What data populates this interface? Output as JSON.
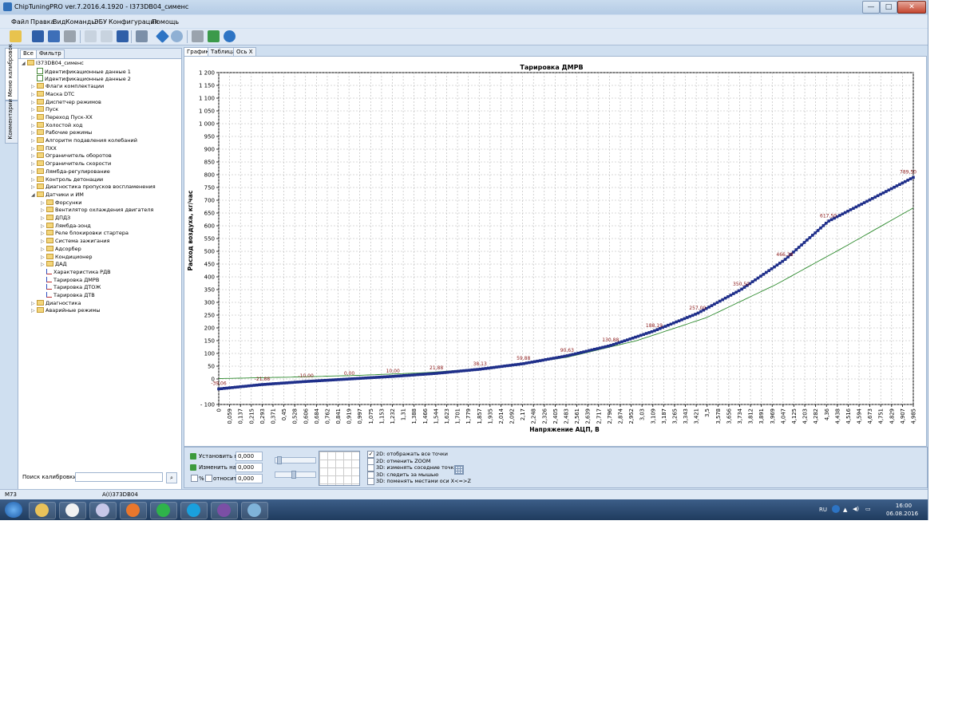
{
  "window": {
    "title": "ChipTuningPRO ver.7.2016.4.1920 - I373DB04_сименс",
    "min": "—",
    "max": "□",
    "close": "✕"
  },
  "menu": [
    "Файл",
    "Правка",
    "Вид",
    "Команды",
    "ЭБУ",
    "Конфигурация",
    "Помощь"
  ],
  "toolbar_icons": [
    "open-folder-icon",
    "save-icon",
    "save-as-icon",
    "print-icon",
    "copy-icon",
    "paste-icon",
    "undo-icon",
    "connect-icon",
    "diamond-icon",
    "search-icon",
    "tools-icon",
    "refresh-icon",
    "help-icon"
  ],
  "vertical_tabs": [
    "Меню калибровок",
    "Комментарии"
  ],
  "sidebar": {
    "tabs": [
      "Все",
      "Фильтр"
    ],
    "tree": [
      {
        "label": "I373DB04_сименс",
        "level": 0,
        "icon": "folder",
        "arrow": "◢"
      },
      {
        "label": "Идентификационные данные 1",
        "level": 1,
        "icon": "table",
        "arrow": ""
      },
      {
        "label": "Идентификационные данные 2",
        "level": 1,
        "icon": "table",
        "arrow": ""
      },
      {
        "label": "Флаги комплектации",
        "level": 1,
        "icon": "folder",
        "arrow": "▷"
      },
      {
        "label": "Маска DTC",
        "level": 1,
        "icon": "folder",
        "arrow": "▷"
      },
      {
        "label": "Диспетчер режимов",
        "level": 1,
        "icon": "folder",
        "arrow": "▷"
      },
      {
        "label": "Пуск",
        "level": 1,
        "icon": "folder",
        "arrow": "▷"
      },
      {
        "label": "Переход Пуск-ХХ",
        "level": 1,
        "icon": "folder",
        "arrow": "▷"
      },
      {
        "label": "Холостой ход",
        "level": 1,
        "icon": "folder",
        "arrow": "▷"
      },
      {
        "label": "Рабочие режимы",
        "level": 1,
        "icon": "folder",
        "arrow": "▷"
      },
      {
        "label": "Алгоритм подавления колебаний",
        "level": 1,
        "icon": "folder",
        "arrow": "▷"
      },
      {
        "label": "ПХХ",
        "level": 1,
        "icon": "folder",
        "arrow": "▷"
      },
      {
        "label": "Ограничитель оборотов",
        "level": 1,
        "icon": "folder",
        "arrow": "▷"
      },
      {
        "label": "Ограничитель скорости",
        "level": 1,
        "icon": "folder",
        "arrow": "▷"
      },
      {
        "label": "Лямбда-регулирование",
        "level": 1,
        "icon": "folder",
        "arrow": "▷"
      },
      {
        "label": "Контроль детонации",
        "level": 1,
        "icon": "folder",
        "arrow": "▷"
      },
      {
        "label": "Диагностика пропусков воспламенения",
        "level": 1,
        "icon": "folder",
        "arrow": "▷"
      },
      {
        "label": "Датчики и ИМ",
        "level": 1,
        "icon": "folder",
        "arrow": "◢"
      },
      {
        "label": "Форсунки",
        "level": 2,
        "icon": "folder",
        "arrow": "▷"
      },
      {
        "label": "Вентилятор охлаждения двигателя",
        "level": 2,
        "icon": "folder",
        "arrow": "▷"
      },
      {
        "label": "ДПДЗ",
        "level": 2,
        "icon": "folder",
        "arrow": "▷"
      },
      {
        "label": "Лямбда-зонд",
        "level": 2,
        "icon": "folder",
        "arrow": "▷"
      },
      {
        "label": "Реле блокировки стартера",
        "level": 2,
        "icon": "folder",
        "arrow": "▷"
      },
      {
        "label": "Система зажигания",
        "level": 2,
        "icon": "folder",
        "arrow": "▷"
      },
      {
        "label": "Адсорбер",
        "level": 2,
        "icon": "folder",
        "arrow": "▷"
      },
      {
        "label": "Кондиционер",
        "level": 2,
        "icon": "folder",
        "arrow": "▷"
      },
      {
        "label": "ДАД",
        "level": 2,
        "icon": "folder",
        "arrow": "▷"
      },
      {
        "label": "Характеристика РДВ",
        "level": 2,
        "icon": "chart",
        "arrow": ""
      },
      {
        "label": "Тарировка ДМРВ",
        "level": 2,
        "icon": "chart",
        "arrow": ""
      },
      {
        "label": "Тарировка ДТОЖ",
        "level": 2,
        "icon": "chart",
        "arrow": ""
      },
      {
        "label": "Тарировка ДТВ",
        "level": 2,
        "icon": "chart",
        "arrow": ""
      },
      {
        "label": "Диагностика",
        "level": 1,
        "icon": "folder",
        "arrow": "▷"
      },
      {
        "label": "Аварийные режимы",
        "level": 1,
        "icon": "folder",
        "arrow": "▷"
      }
    ],
    "search_label": "Поиск калибровки",
    "search_value": ""
  },
  "status": {
    "left": "M73",
    "mid": "A(I)373DB04"
  },
  "chart_tabs": [
    "График",
    "Таблица",
    "Ось X"
  ],
  "controls": {
    "set_label": "Установить в",
    "set_value": "0,000",
    "change_label": "Изменить на",
    "change_value": "0,000",
    "pct_label": "%",
    "rel_label": "относит.",
    "rel_value": "0,000",
    "options": [
      {
        "label": "2D: отображать все точки",
        "checked": true
      },
      {
        "label": "2D: отменить ZOOM",
        "checked": false
      },
      {
        "label": "3D: изменять соседние точки",
        "checked": false
      },
      {
        "label": "3D: следить за мышью",
        "checked": false
      },
      {
        "label": "3D: поменять местами оси X<=>Z",
        "checked": false
      }
    ],
    "check_mark": "✓"
  },
  "taskbar": {
    "apps": [
      {
        "name": "explorer",
        "color": "#e9c25a"
      },
      {
        "name": "paint",
        "color": "#f2f2f2"
      },
      {
        "name": "tool",
        "color": "#c7c7e8"
      },
      {
        "name": "firefox",
        "color": "#e9772d"
      },
      {
        "name": "mail",
        "color": "#2fb34a"
      },
      {
        "name": "skype",
        "color": "#1aa0dd"
      },
      {
        "name": "viber",
        "color": "#7b4fa5"
      },
      {
        "name": "chiptuning",
        "color": "#7fb3d9"
      }
    ],
    "lang": "RU",
    "time": "16:00",
    "date": "06.08.2016"
  },
  "chart_data": {
    "type": "line",
    "title": "Тарировка ДМРВ",
    "xlabel": "Напряжение АЦП, В",
    "ylabel": "Расход воздуха, кг/час",
    "ylim": [
      -100,
      1200
    ],
    "ytick_labels": [
      "- 100",
      "0",
      "50",
      "100",
      "150",
      "200",
      "250",
      "300",
      "350",
      "400",
      "450",
      "500",
      "550",
      "600",
      "650",
      "700",
      "750",
      "800",
      "850",
      "900",
      "950",
      "1 000",
      "1 050",
      "1 100",
      "1 150",
      "1 200"
    ],
    "x_tick_labels": [
      "0",
      "0,059",
      "0,137",
      "0,215",
      "0,293",
      "0,371",
      "0,45",
      "0,528",
      "0,606",
      "0,684",
      "0,762",
      "0,841",
      "0,919",
      "0,997",
      "1,075",
      "1,153",
      "1,232",
      "1,31",
      "1,388",
      "1,466",
      "1,544",
      "1,623",
      "1,701",
      "1,779",
      "1,857",
      "1,935",
      "2,014",
      "2,092",
      "2,17",
      "2,248",
      "2,326",
      "2,405",
      "2,483",
      "2,561",
      "2,639",
      "2,717",
      "2,796",
      "2,874",
      "2,952",
      "3,03",
      "3,109",
      "3,187",
      "3,265",
      "3,343",
      "3,421",
      "3,5",
      "3,578",
      "3,656",
      "3,734",
      "3,812",
      "3,891",
      "3,969",
      "4,047",
      "4,125",
      "4,203",
      "4,282",
      "4,36",
      "4,438",
      "4,516",
      "4,594",
      "4,673",
      "4,751",
      "4,829",
      "4,907",
      "4,985"
    ],
    "grid": true,
    "series": [
      {
        "color": "#1f2f8a",
        "style": "markers",
        "points": [
          [
            0,
            -39.06
          ],
          [
            0.312,
            -21.88
          ],
          [
            0.625,
            -10.0
          ],
          [
            0.937,
            0.0
          ],
          [
            1.25,
            10.0
          ],
          [
            1.562,
            21.88
          ],
          [
            1.875,
            38.13
          ],
          [
            2.187,
            59.88
          ],
          [
            2.5,
            90.63
          ],
          [
            2.812,
            130.88
          ],
          [
            3.125,
            188.19
          ],
          [
            3.437,
            257.0
          ],
          [
            3.75,
            350.5
          ],
          [
            4.062,
            466.38
          ],
          [
            4.375,
            617.5
          ],
          [
            4.985,
            789.5
          ]
        ]
      },
      {
        "color": "#2e8b2e",
        "style": "line",
        "points": [
          [
            0,
            1.5
          ],
          [
            0.5,
            7
          ],
          [
            1.0,
            14
          ],
          [
            1.5,
            25
          ],
          [
            2.0,
            45
          ],
          [
            2.5,
            85
          ],
          [
            3.0,
            150
          ],
          [
            3.5,
            240
          ],
          [
            4.0,
            370
          ],
          [
            4.5,
            520
          ],
          [
            4.985,
            670
          ]
        ]
      }
    ],
    "data_labels": [
      "-39,06",
      "-21,88",
      "-10,00",
      "0,00",
      "10,00",
      "21,88",
      "38,13",
      "59,88",
      "90,63",
      "130,88",
      "188,19",
      "257,00",
      "350,50",
      "466,38",
      "617,50",
      "789,50"
    ]
  }
}
